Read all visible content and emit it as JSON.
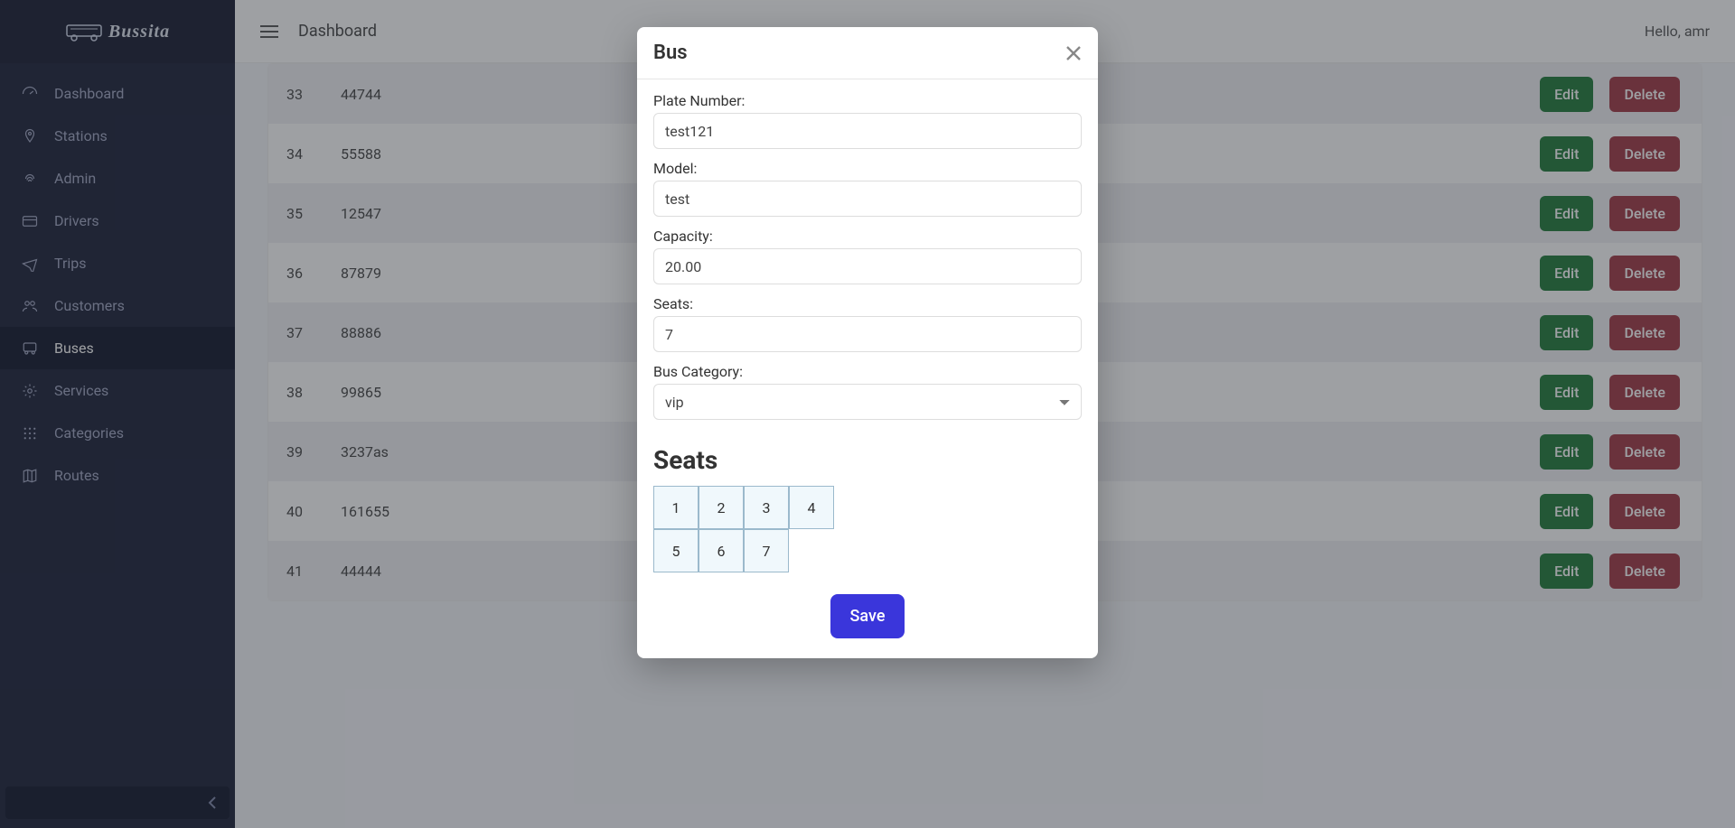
{
  "brand": "Bussita",
  "header": {
    "page": "Dashboard",
    "greeting": "Hello, amr"
  },
  "sidebar": {
    "items": [
      {
        "label": "Dashboard",
        "icon": "dashboard-icon"
      },
      {
        "label": "Stations",
        "icon": "pin-icon"
      },
      {
        "label": "Admin",
        "icon": "fingerprint-icon"
      },
      {
        "label": "Drivers",
        "icon": "card-icon"
      },
      {
        "label": "Trips",
        "icon": "plane-icon"
      },
      {
        "label": "Customers",
        "icon": "users-icon"
      },
      {
        "label": "Buses",
        "icon": "bus-icon"
      },
      {
        "label": "Services",
        "icon": "gear-icon"
      },
      {
        "label": "Categories",
        "icon": "grid-icon"
      },
      {
        "label": "Routes",
        "icon": "map-icon"
      }
    ],
    "active_index": 6
  },
  "table": {
    "edit_label": "Edit",
    "delete_label": "Delete",
    "rows": [
      {
        "id": "33",
        "plate": "44744"
      },
      {
        "id": "34",
        "plate": "55588"
      },
      {
        "id": "35",
        "plate": "12547"
      },
      {
        "id": "36",
        "plate": "87879"
      },
      {
        "id": "37",
        "plate": "88886"
      },
      {
        "id": "38",
        "plate": "99865"
      },
      {
        "id": "39",
        "plate": "3237as"
      },
      {
        "id": "40",
        "plate": "161655"
      },
      {
        "id": "41",
        "plate": "44444"
      }
    ]
  },
  "modal": {
    "title": "Bus",
    "fields": {
      "plate_label": "Plate Number:",
      "plate_value": "test121",
      "model_label": "Model:",
      "model_value": "test",
      "capacity_label": "Capacity:",
      "capacity_value": "20.00",
      "seats_label": "Seats:",
      "seats_value": "7",
      "category_label": "Bus Category:",
      "category_value": "vip"
    },
    "seats_section_title": "Seats",
    "seats": [
      "1",
      "2",
      "3",
      "4",
      "5",
      "6",
      "7"
    ],
    "save_label": "Save"
  }
}
